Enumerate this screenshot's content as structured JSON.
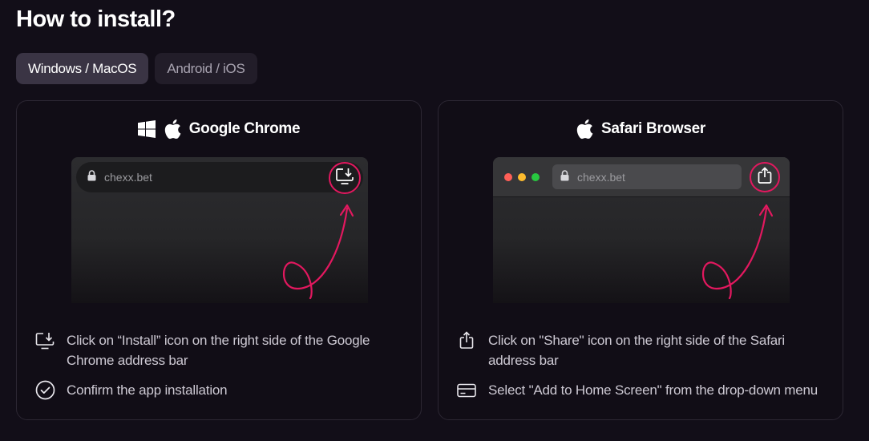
{
  "page": {
    "title": "How to install?"
  },
  "tabs": [
    {
      "label": "Windows / MacOS",
      "active": true
    },
    {
      "label": "Android / iOS",
      "active": false
    }
  ],
  "cards": [
    {
      "title": "Google Chrome",
      "icons": [
        "windows-icon",
        "apple-icon"
      ],
      "url": "chexx.bet",
      "highlighted_icon": "install-icon",
      "steps": [
        {
          "icon": "install-icon",
          "text": "Click on “Install” icon on the right side of the Google Chrome address bar"
        },
        {
          "icon": "check-circle-icon",
          "text": "Confirm the app installation"
        }
      ]
    },
    {
      "title": "Safari Browser",
      "icons": [
        "apple-icon"
      ],
      "url": "chexx.bet",
      "highlighted_icon": "share-icon",
      "steps": [
        {
          "icon": "share-icon",
          "text": "Click on \"Share\" icon on the right side of the Safari address bar"
        },
        {
          "icon": "card-icon",
          "text": "Select \"Add to Home Screen\" from the drop-down menu"
        }
      ]
    }
  ],
  "colors": {
    "background": "#120e18",
    "accent": "#e3185f",
    "tab_active": "#3a3444",
    "tab_inactive": "#221d29",
    "traffic_red": "#ff5f57",
    "traffic_yellow": "#febc2e",
    "traffic_green": "#28c840"
  }
}
